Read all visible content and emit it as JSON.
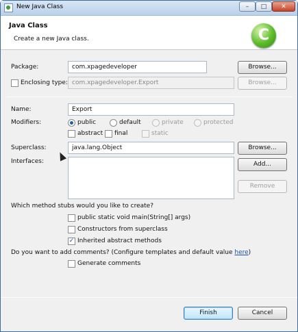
{
  "window": {
    "title": "New Java Class",
    "min": "–",
    "max": "□",
    "close": "✕"
  },
  "header": {
    "title": "Java Class",
    "description": "Create a new Java class.",
    "icon": "class-icon",
    "icon_glyph": "C"
  },
  "package": {
    "label": "Package:",
    "value": "com.xpagedeveloper",
    "browse": "Browse..."
  },
  "enclosing": {
    "label": "Enclosing type:",
    "checked": false,
    "value": "com.xpagedeveloper.Export",
    "browse": "Browse..."
  },
  "name": {
    "label": "Name:",
    "value": "Export"
  },
  "modifiers": {
    "label": "Modifiers:",
    "access": [
      "public",
      "default",
      "private",
      "protected"
    ],
    "selected": "public",
    "other": [
      "abstract",
      "final",
      "static"
    ]
  },
  "superclass": {
    "label": "Superclass:",
    "value": "java.lang.Object",
    "browse": "Browse..."
  },
  "interfaces": {
    "label": "Interfaces:",
    "add": "Add...",
    "remove": "Remove",
    "items": []
  },
  "stubs": {
    "question": "Which method stubs would you like to create?",
    "options": [
      {
        "label": "public static void main(String[] args)",
        "checked": false
      },
      {
        "label": "Constructors from superclass",
        "checked": false
      },
      {
        "label": "Inherited abstract methods",
        "checked": true
      }
    ]
  },
  "comments": {
    "question_prefix": "Do you want to add comments? (Configure templates and default value ",
    "link": "here",
    "question_suffix": ")",
    "option": "Generate comments",
    "checked": false
  },
  "buttons": {
    "finish": "Finish",
    "cancel": "Cancel"
  },
  "colors": {
    "accent": "#3c7fb1",
    "link": "#1a4fb0"
  }
}
